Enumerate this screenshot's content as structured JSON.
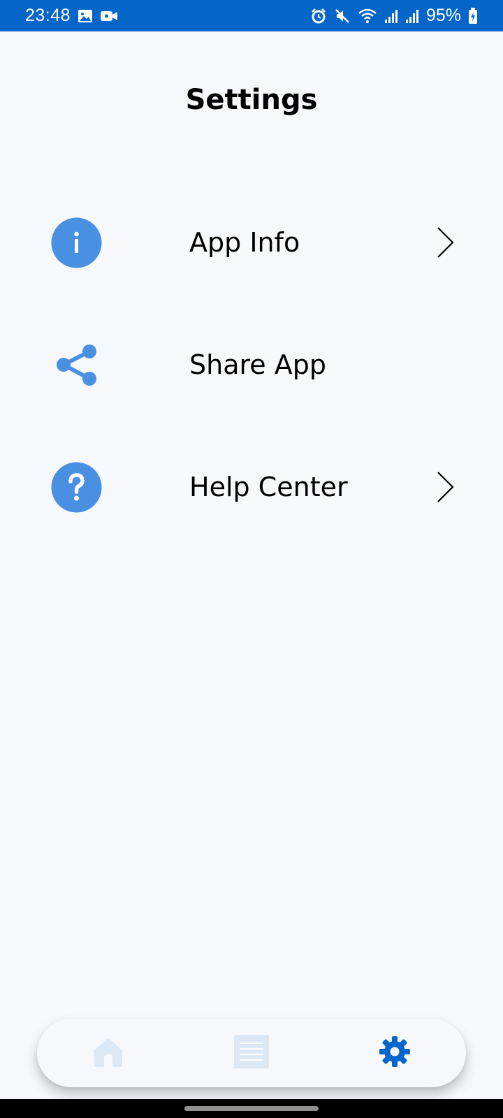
{
  "status_bar": {
    "time": "23:48",
    "battery_text": "95%",
    "icons": [
      "image-icon",
      "video-icon",
      "alarm-icon",
      "mute-icon",
      "wifi-icon",
      "signal-icon",
      "signal-icon-2",
      "battery-charging-icon"
    ]
  },
  "header": {
    "title": "Settings"
  },
  "settings": {
    "items": [
      {
        "label": "App Info",
        "icon": "info-icon",
        "has_chevron": true
      },
      {
        "label": "Share App",
        "icon": "share-icon",
        "has_chevron": false
      },
      {
        "label": "Help Center",
        "icon": "help-icon",
        "has_chevron": true
      }
    ]
  },
  "bottom_nav": {
    "items": [
      {
        "name": "home",
        "icon": "home-icon",
        "active": false
      },
      {
        "name": "list",
        "icon": "list-icon",
        "active": false
      },
      {
        "name": "settings",
        "icon": "gear-icon",
        "active": true
      }
    ]
  },
  "colors": {
    "status_bar": "#0466c8",
    "accent": "#4a90e2",
    "nav_active": "#0466c8",
    "nav_inactive": "#dce9f5",
    "background": "#f7f8fb"
  }
}
